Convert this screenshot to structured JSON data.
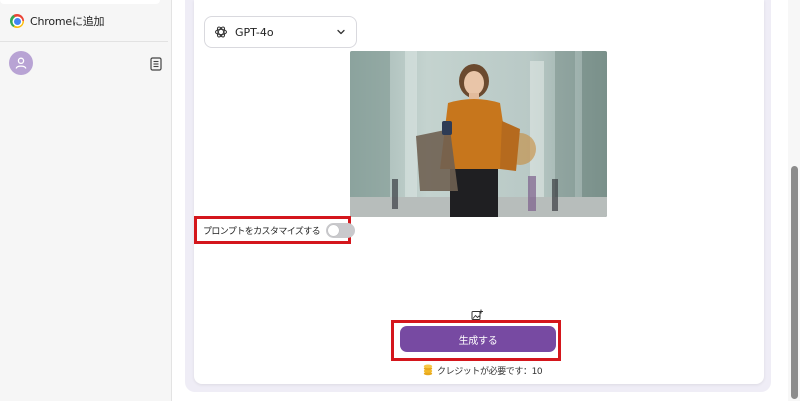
{
  "sidebar": {
    "chrome_add_label": "Chromeに追加",
    "icons": {
      "logo": "chrome-logo-icon",
      "avatar": "user-icon",
      "notes": "notes-icon"
    }
  },
  "generator": {
    "model_select": {
      "selected": "GPT-4o",
      "icon": "openai-icon"
    },
    "custom_prompt": {
      "label": "プロンプトをカスタマイズする",
      "enabled": false
    },
    "generate_button": {
      "label": "生成する"
    },
    "credit_text": "クレジットが必要です：10",
    "add_image_icon": "image-plus-icon",
    "coin_icon": "coins-icon"
  },
  "colors": {
    "accent_button": "#774aa2",
    "highlight_red": "#d4161c",
    "panel_tint": "#efedf6",
    "avatar": "#b8a3d4"
  }
}
